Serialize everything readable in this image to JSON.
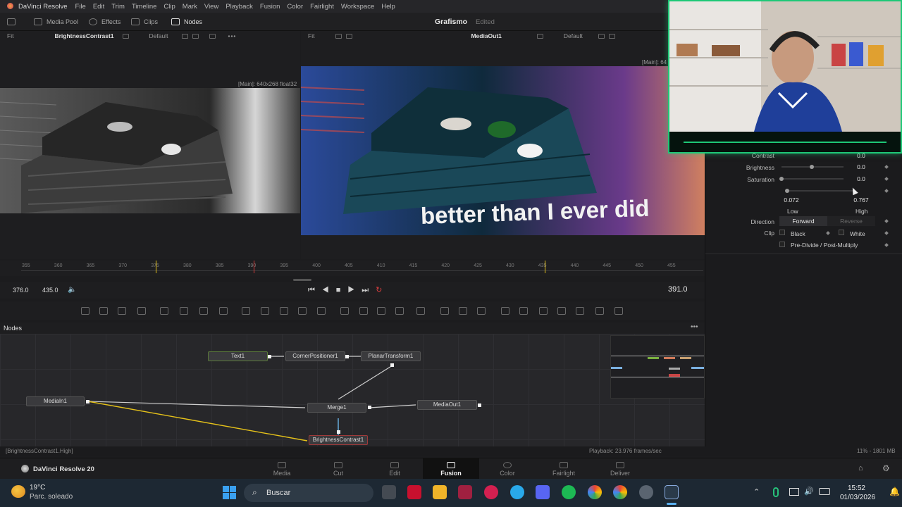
{
  "menubar": {
    "app_name": "DaVinci Resolve",
    "items": [
      "File",
      "Edit",
      "Trim",
      "Timeline",
      "Clip",
      "Mark",
      "View",
      "Playback",
      "Fusion",
      "Color",
      "Fairlight",
      "Workspace",
      "Help"
    ]
  },
  "toolbar": {
    "media_pool": "Media Pool",
    "effects": "Effects",
    "clips": "Clips",
    "nodes": "Nodes",
    "project_title": "Grafismo",
    "project_state": "Edited"
  },
  "viewer_left": {
    "fit": "Fit",
    "node_name": "BrightnessContrast1",
    "lut": "Default",
    "resolution": "[Main]: 640x268 float32"
  },
  "viewer_right": {
    "fit": "Fit",
    "node_name": "MediaOut1",
    "lut": "Default",
    "resolution": "[Main]: 64",
    "caption": "better than I ever did"
  },
  "inspector": {
    "contrast_label": "Contrast",
    "contrast_value": "0.0",
    "brightness_label": "Brightness",
    "brightness_value": "0.0",
    "saturation_label": "Saturation",
    "saturation_value": "0.0",
    "low_value": "0.072",
    "high_value": "0.767",
    "low_label": "Low",
    "high_label": "High",
    "direction_label": "Direction",
    "direction_forward": "Forward",
    "direction_reverse": "Reverse",
    "clip_label": "Clip",
    "clip_black": "Black",
    "clip_white": "White",
    "predivide": "Pre-Divide / Post-Multiply"
  },
  "ruler": {
    "ticks": [
      "355",
      "360",
      "365",
      "370",
      "375",
      "380",
      "385",
      "390",
      "395",
      "400",
      "405",
      "410",
      "415",
      "420",
      "425",
      "430",
      "435",
      "440",
      "445",
      "450",
      "455"
    ]
  },
  "transport": {
    "in_value": "376.0",
    "out_value": "435.0",
    "current_frame": "391.0"
  },
  "nodes_panel": {
    "title": "Nodes",
    "node_labels": {
      "text1": "Text1",
      "corner": "CornerPositioner1",
      "planar": "PlanarTransform1",
      "mediain": "MediaIn1",
      "merge": "Merge1",
      "mediaout": "MediaOut1",
      "bc": "BrightnessContrast1"
    }
  },
  "statusbar": {
    "left": "[BrightnessContrast1.High]",
    "playback": "Playback: 23.976 frames/sec",
    "memory": "11% - 1801 MB"
  },
  "pagebar": {
    "app_version": "DaVinci Resolve 20",
    "pages": [
      "Media",
      "Cut",
      "Edit",
      "Fusion",
      "Color",
      "Fairlight",
      "Deliver"
    ],
    "active": "Fusion"
  },
  "taskbar": {
    "weather_temp": "19°C",
    "weather_desc": "Parc. soleado",
    "search_placeholder": "Buscar",
    "time": "15:52",
    "date": "01/03/2026"
  },
  "colors": {
    "accent_green": "#1ec877",
    "node_yellow": "#e6c21a",
    "fusion_active": "#f0f0f0"
  }
}
